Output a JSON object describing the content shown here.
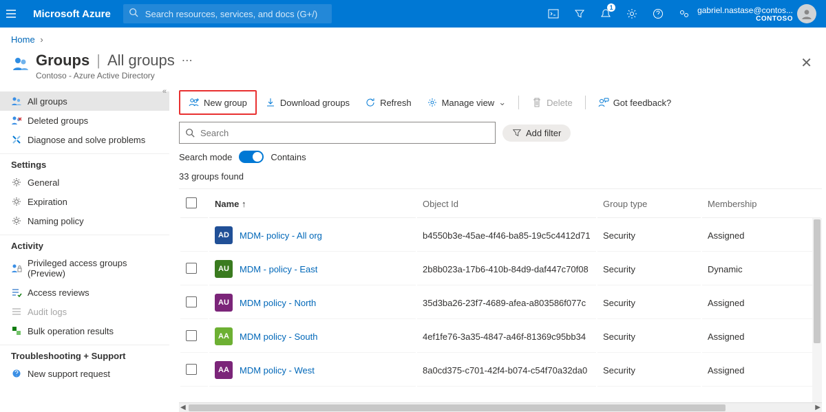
{
  "topbar": {
    "brand": "Microsoft Azure",
    "search_placeholder": "Search resources, services, and docs (G+/)",
    "notification_count": "1",
    "user_email": "gabriel.nastase@contos...",
    "user_org": "CONTOSO"
  },
  "breadcrumb": {
    "home": "Home"
  },
  "page": {
    "title": "Groups",
    "section": "All groups",
    "subtitle": "Contoso - Azure Active Directory"
  },
  "sidebar": {
    "sections": [
      {
        "label": "",
        "items": [
          {
            "label": "All groups"
          },
          {
            "label": "Deleted groups"
          },
          {
            "label": "Diagnose and solve problems"
          }
        ]
      },
      {
        "label": "Settings",
        "items": [
          {
            "label": "General"
          },
          {
            "label": "Expiration"
          },
          {
            "label": "Naming policy"
          }
        ]
      },
      {
        "label": "Activity",
        "items": [
          {
            "label": "Privileged access groups (Preview)"
          },
          {
            "label": "Access reviews"
          },
          {
            "label": "Audit logs"
          },
          {
            "label": "Bulk operation results"
          }
        ]
      },
      {
        "label": "Troubleshooting + Support",
        "items": [
          {
            "label": "New support request"
          }
        ]
      }
    ]
  },
  "toolbar": {
    "new_group": "New group",
    "download": "Download groups",
    "refresh": "Refresh",
    "manage_view": "Manage view",
    "delete": "Delete",
    "feedback": "Got feedback?"
  },
  "filter": {
    "search_placeholder": "Search",
    "add_filter": "Add filter",
    "search_mode_label": "Search mode",
    "toggle_label": "Contains"
  },
  "results": {
    "count_text": "33 groups found",
    "columns": {
      "name": "Name",
      "object_id": "Object Id",
      "group_type": "Group type",
      "membership": "Membership"
    },
    "rows": [
      {
        "initials": "AD",
        "color": "#215097",
        "name": "MDM- policy - All org",
        "object_id": "b4550b3e-45ae-4f46-ba85-19c5c4412d71",
        "group_type": "Security",
        "membership": "Assigned"
      },
      {
        "initials": "AU",
        "color": "#3a7b1f",
        "name": "MDM - policy - East",
        "object_id": "2b8b023a-17b6-410b-84d9-daf447c70f08",
        "group_type": "Security",
        "membership": "Dynamic"
      },
      {
        "initials": "AU",
        "color": "#7b2579",
        "name": "MDM policy - North",
        "object_id": "35d3ba26-23f7-4689-afea-a803586f077c",
        "group_type": "Security",
        "membership": "Assigned"
      },
      {
        "initials": "AA",
        "color": "#6db033",
        "name": "MDM policy - South",
        "object_id": "4ef1fe76-3a35-4847-a46f-81369c95bb34",
        "group_type": "Security",
        "membership": "Assigned"
      },
      {
        "initials": "AA",
        "color": "#7b2579",
        "name": "MDM policy - West",
        "object_id": "8a0cd375-c701-42f4-b074-c54f70a32da0",
        "group_type": "Security",
        "membership": "Assigned"
      }
    ]
  }
}
